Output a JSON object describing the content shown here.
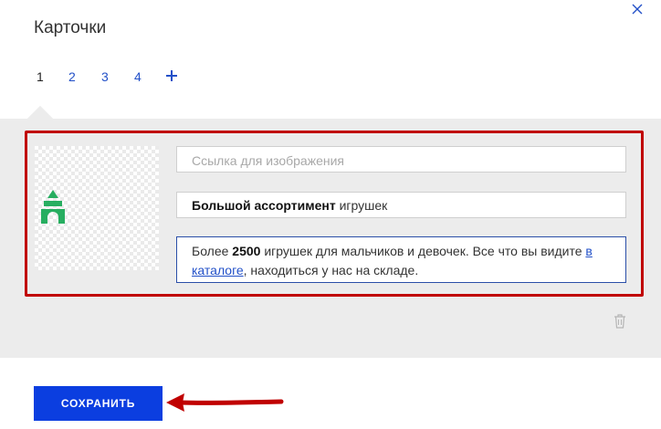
{
  "dialog": {
    "title": "Карточки"
  },
  "tabs": [
    {
      "label": "1",
      "active": true
    },
    {
      "label": "2",
      "active": false
    },
    {
      "label": "3",
      "active": false
    },
    {
      "label": "4",
      "active": false
    }
  ],
  "card": {
    "image_url_placeholder": "Ссылка для изображения",
    "title_bold": "Большой ассортимент",
    "title_rest": " игрушек",
    "desc_part1": "Более ",
    "desc_bold": "2500",
    "desc_part2": " игрушек для мальчиков и девочек. Все что вы видите ",
    "desc_link": "в каталоге",
    "desc_part3": ", находиться у нас на складе."
  },
  "footer": {
    "save_label": "СОХРАНИТЬ"
  },
  "colors": {
    "accent": "#0b3ee0",
    "link": "#2250c8",
    "highlight": "#c00000",
    "panel": "#ececec",
    "logo": "#27ae60"
  },
  "icons": {
    "close": "close-icon",
    "add": "plus-icon",
    "delete": "trash-icon",
    "logo": "castle-logo-icon"
  }
}
